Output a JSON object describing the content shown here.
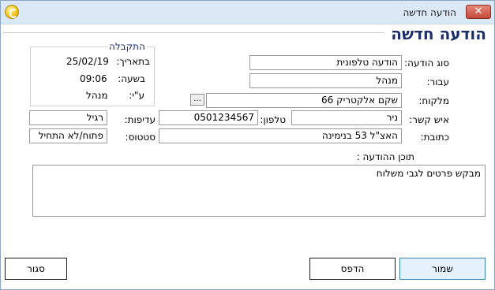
{
  "window": {
    "title": "הודעה חדשה",
    "close_glyph": "✕"
  },
  "page": {
    "heading": "הודעה חדשה"
  },
  "received_group": {
    "title": "התקבלה",
    "date_label": "בתאריך:",
    "date_value": "25/02/19",
    "time_label": "בשעה:",
    "time_value": "09:06",
    "by_label": "ע\"י:",
    "by_value": "מנהל"
  },
  "form": {
    "message_type_label": "סוג הודעה:",
    "message_type_value": "הודעה טלפונית",
    "for_label": "עבור:",
    "for_value": "מנהל",
    "customer_label": "מלקוח:",
    "customer_value": "שקם אלקטריק  66",
    "browse_label": "...",
    "contact_label": "איש קשר:",
    "contact_value": "ניר",
    "phone_label": "טלפון:",
    "phone_value": "0501234567",
    "priority_label": "עדיפות:",
    "priority_value": "רגיל",
    "address_label": "כתובת:",
    "address_value": "האצ\"ל 53 בנימינה",
    "status_label": "סטטוס:",
    "status_value": "פתוח/לא התחיל",
    "content_label": "תוכן ההודעה :",
    "content_value": "מבקש פרטים לגבי משלוח"
  },
  "buttons": {
    "save": "שמור",
    "print": "הדפס",
    "close": "סגור"
  }
}
